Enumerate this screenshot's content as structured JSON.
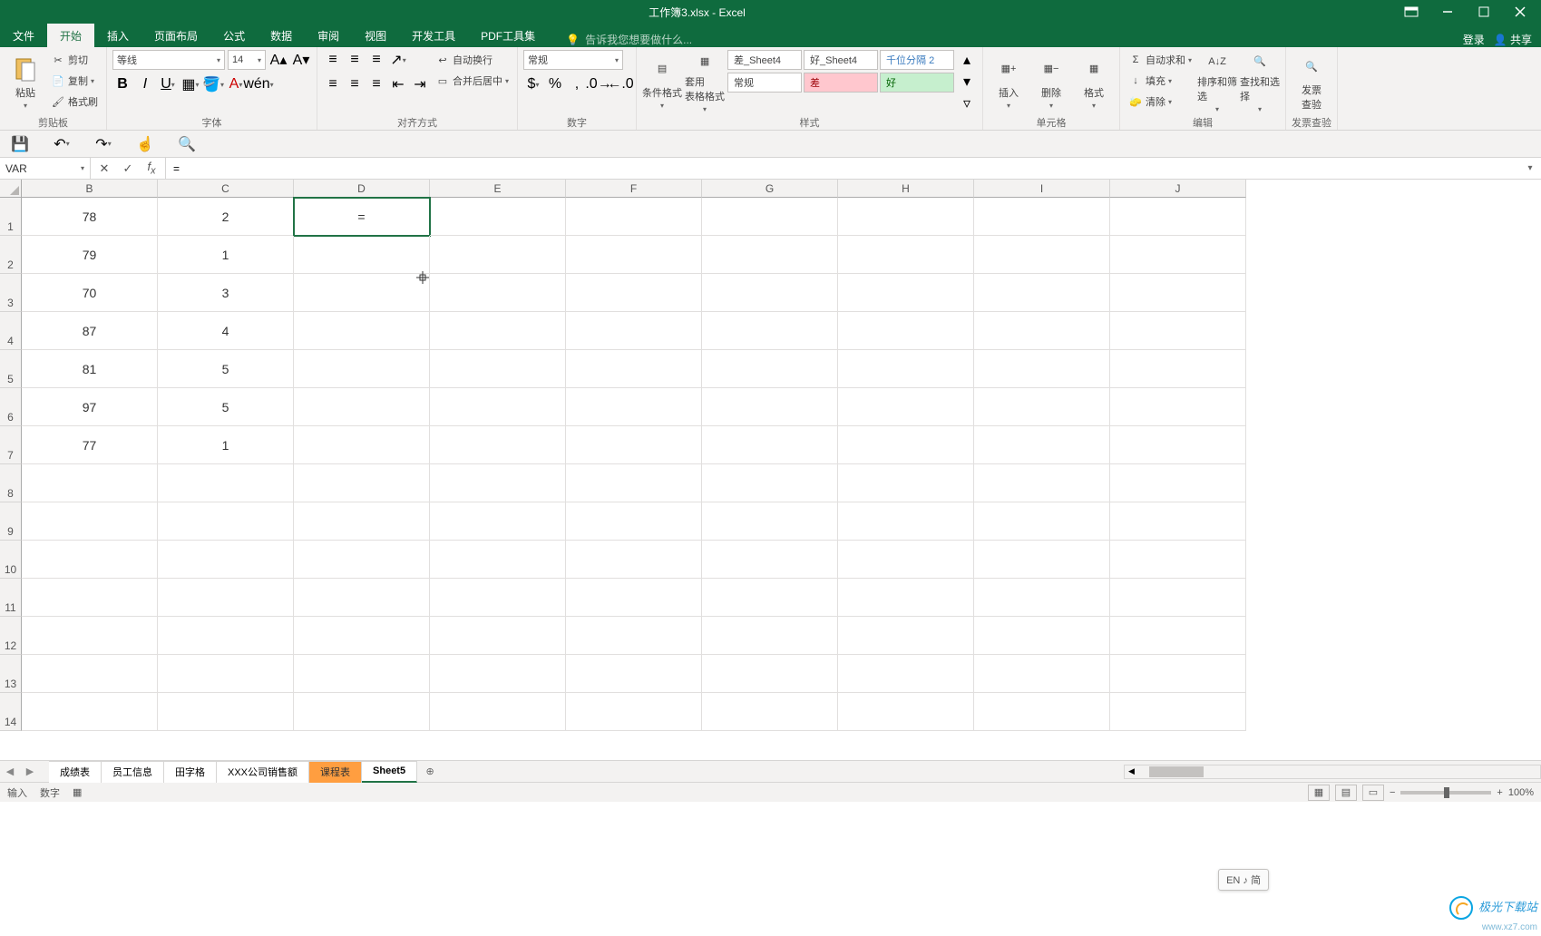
{
  "titlebar": {
    "title": "工作簿3.xlsx - Excel"
  },
  "menurow": {
    "tabs": [
      "文件",
      "开始",
      "插入",
      "页面布局",
      "公式",
      "数据",
      "审阅",
      "视图",
      "开发工具",
      "PDF工具集"
    ],
    "tellme": "告诉我您想要做什么...",
    "login": "登录",
    "share": "共享"
  },
  "ribbon": {
    "clipboard": {
      "paste": "粘贴",
      "cut": "剪切",
      "copy": "复制",
      "format_painter": "格式刷",
      "label": "剪贴板"
    },
    "font": {
      "name": "等线",
      "size": "14",
      "label": "字体"
    },
    "align": {
      "wrap": "自动换行",
      "merge": "合并后居中",
      "label": "对齐方式"
    },
    "number": {
      "format": "常规",
      "label": "数字"
    },
    "styles": {
      "cond": "条件格式",
      "table": "套用\n表格格式",
      "s1": "差_Sheet4",
      "s2": "好_Sheet4",
      "s3": "千位分隔 2",
      "s4": "常规",
      "s5": "差",
      "s6": "好",
      "label": "样式"
    },
    "cells": {
      "insert": "插入",
      "delete": "删除",
      "format": "格式",
      "label": "单元格"
    },
    "editing": {
      "autosum": "自动求和",
      "fill": "填充",
      "clear": "清除",
      "sort": "排序和筛选",
      "find": "查找和选择",
      "label": "编辑"
    },
    "invoice": {
      "btn": "发票\n查验",
      "label": "发票查验"
    }
  },
  "fbar": {
    "name": "VAR",
    "formula": "="
  },
  "columns": [
    "",
    "B",
    "C",
    "D",
    "E",
    "F",
    "G",
    "H",
    "I",
    "J"
  ],
  "rows": [
    "1",
    "2",
    "3",
    "4",
    "5",
    "6",
    "7",
    "8",
    "9",
    "10",
    "11",
    "12",
    "13",
    "14"
  ],
  "cells": {
    "B1": "78",
    "C1": "2",
    "D1": "=",
    "B2": "79",
    "C2": "1",
    "B3": "70",
    "C3": "3",
    "B4": "87",
    "C4": "4",
    "B5": "81",
    "C5": "5",
    "B6": "97",
    "C6": "5",
    "B7": "77",
    "C7": "1"
  },
  "sheets": [
    "成绩表",
    "员工信息",
    "田字格",
    "XXX公司销售额",
    "课程表",
    "Sheet5"
  ],
  "status": {
    "mode": "输入",
    "numlock": "数字",
    "zoom": "100%"
  },
  "ime": "EN ♪ 简",
  "watermark": {
    "cn": "极光下载站",
    "url": "www.xz7.com"
  }
}
